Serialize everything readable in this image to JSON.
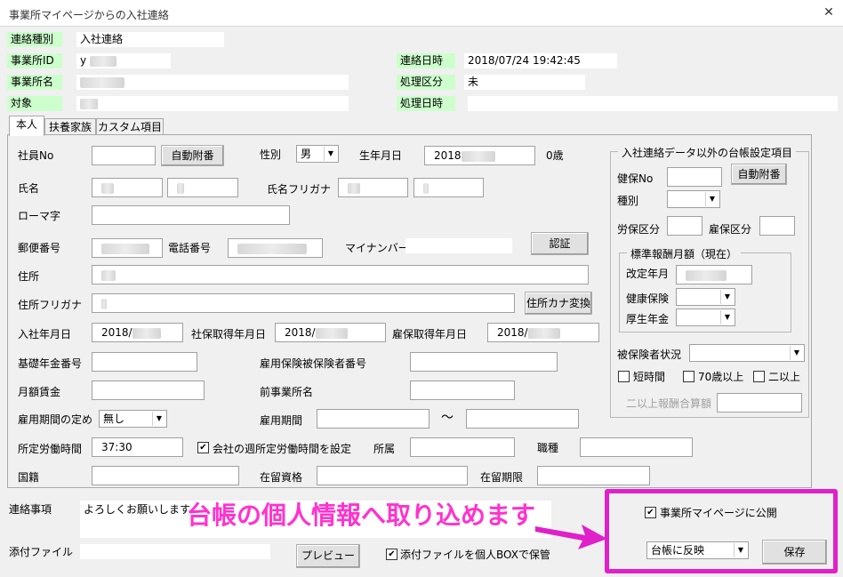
{
  "window": {
    "title": "事業所マイページからの入社連絡",
    "close_glyph": "✕"
  },
  "header": {
    "renraku_shubetsu_label": "連絡種別",
    "renraku_shubetsu_value": "入社連絡",
    "jigyosho_id_label": "事業所ID",
    "jigyosho_id_value": "y",
    "jigyosho_mei_label": "事業所名",
    "taisho_label": "対象",
    "renraku_nichiji_label": "連絡日時",
    "renraku_nichiji_value": "2018/07/24 19:42:45",
    "shori_kubun_label": "処理区分",
    "shori_kubun_value": "未",
    "shori_nichiji_label": "処理日時"
  },
  "tabs": [
    {
      "label": "本人"
    },
    {
      "label": "扶養家族"
    },
    {
      "label": "カスタム項目"
    }
  ],
  "form": {
    "shain_no_label": "社員No",
    "auto_number_label": "自動附番",
    "seibetsu_label": "性別",
    "seibetsu_value": "男",
    "seinengappi_label": "生年月日",
    "seinengappi_value": "2018",
    "age_value": "0歳",
    "shimei_label": "氏名",
    "shimei_furigana_label": "氏名フリガナ",
    "romaji_label": "ローマ字",
    "yubin_label": "郵便番号",
    "denwa_label": "電話番号",
    "mynumber_label": "マイナンバー",
    "ninsho_label": "認証",
    "jusho_label": "住所",
    "jusho_furigana_label": "住所フリガナ",
    "kana_henkan_label": "住所カナ変換",
    "nyusha_label": "入社年月日",
    "nyusha_value": "2018/",
    "shaho_label": "社保取得年月日",
    "shaho_value": "2018/",
    "koho_label": "雇保取得年月日",
    "koho_value": "2018/",
    "kiso_nenkin_label": "基礎年金番号",
    "koyo_hoken_no_label": "雇用保険被保険者番号",
    "getsugaku_label": "月額賃金",
    "zen_jigyosho_label": "前事業所名",
    "koyo_kikan_sadame_label": "雇用期間の定め",
    "koyo_kikan_sadame_value": "無し",
    "koyo_kikan_label": "雇用期間",
    "tilde": "～",
    "shotei_label": "所定労働時間",
    "shotei_value": "37:30",
    "kaisha_shotei_label": "会社の週所定労働時間を設定",
    "shozoku_label": "所属",
    "shokushu_label": "職種",
    "kokuseki_label": "国籍",
    "zairyu_shikaku_label": "在留資格",
    "zairyu_kigen_label": "在留期限"
  },
  "side_group": {
    "title": "入社連絡データ以外の台帳設定項目",
    "kenpo_no_label": "健保No",
    "auto_number_label": "自動附番",
    "shubetsu_label": "種別",
    "roho_label": "労保区分",
    "koho_kubun_label": "雇保区分",
    "hyojun_title": "標準報酬月額（現在）",
    "kaitei_label": "改定年月",
    "kenko_label": "健康保険",
    "kosei_label": "厚生年金",
    "hihokensha_label": "被保険者状況",
    "tanjikan_label": "短時間",
    "over70_label": "70歳以上",
    "niijo_label": "二以上",
    "niijo_gassan_label": "二以上報酬合算額"
  },
  "bottom": {
    "renraku_jiko_label": "連絡事項",
    "renraku_jiko_value": "よろしくお願いします",
    "tempu_label": "添付ファイル",
    "preview_label": "プレビュー",
    "tempu_box_label": "添付ファイルを個人BOXで保管",
    "kokai_label": "事業所マイページに公開",
    "daicho_select_value": "台帳に反映",
    "save_label": "保存"
  },
  "annotation": {
    "text": "台帳の個人情報へ取り込めます"
  },
  "colors": {
    "label_green": "#ccffcc",
    "highlight": "#e020c8",
    "annotation_text": "#ff33cc"
  }
}
